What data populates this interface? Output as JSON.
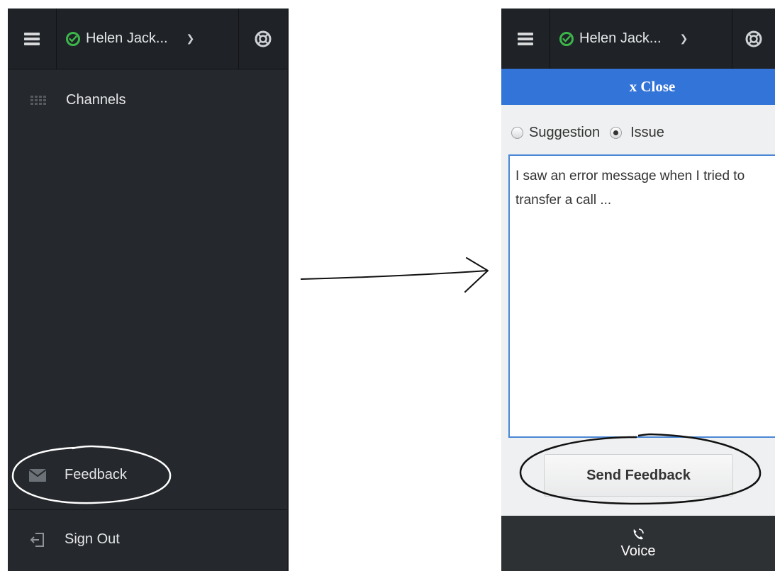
{
  "left_panel": {
    "user_name": "Helen Jack...",
    "menu": {
      "channels": "Channels",
      "feedback": "Feedback",
      "sign_out": "Sign Out"
    }
  },
  "right_panel": {
    "user_name": "Helen Jack...",
    "close_label": "x Close",
    "feedback_types": [
      "Suggestion",
      "Issue"
    ],
    "selected_type": "Issue",
    "feedback_text": "I saw an error message when I tried to transfer a call ...",
    "send_label": "Send Feedback",
    "channel_label": "Voice"
  },
  "colors": {
    "status_available": "#3cb64a",
    "close_bar": "#3374d8",
    "dark_bg": "#25282c"
  },
  "icons": [
    "menu-icon",
    "status-check-icon",
    "chevron-down-icon",
    "support-icon",
    "grid-icon",
    "envelope-icon",
    "sign-out-icon",
    "voice-phone-icon"
  ]
}
